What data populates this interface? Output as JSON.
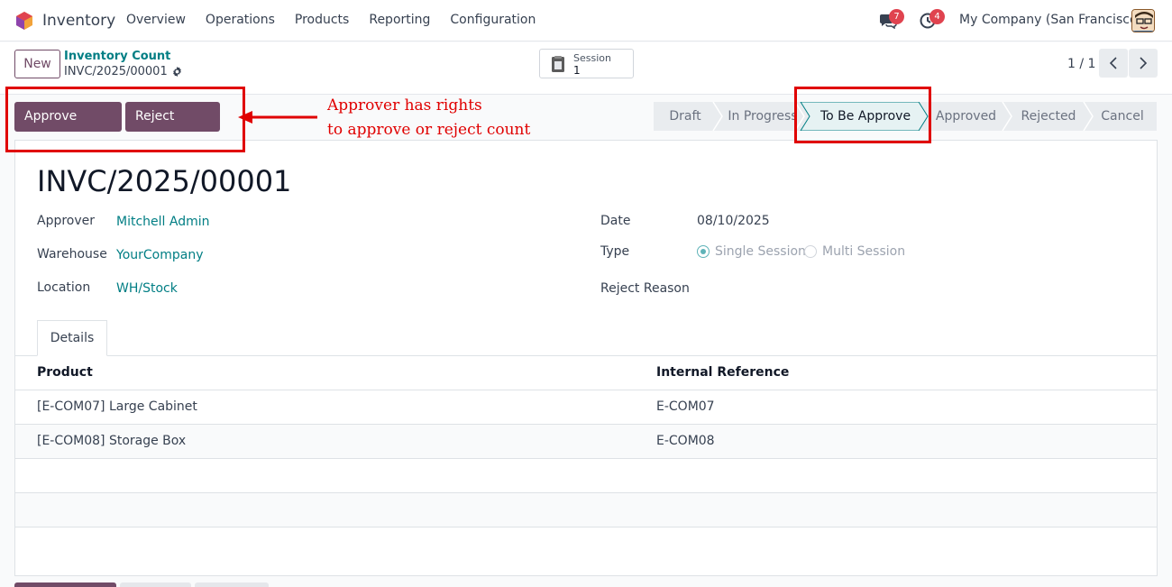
{
  "navbar": {
    "app_name": "Inventory",
    "menu": [
      "Overview",
      "Operations",
      "Products",
      "Reporting",
      "Configuration"
    ],
    "messages_count": "7",
    "activities_count": "4",
    "company": "My Company (San Francisco)"
  },
  "control": {
    "new_label": "New",
    "breadcrumb_parent": "Inventory Count",
    "breadcrumb_current": "INVC/2025/00001",
    "session_label": "Session",
    "session_value": "1",
    "pager": "1 / 1"
  },
  "actions": {
    "approve_label": "Approve Count",
    "reject_label": "Reject Count"
  },
  "statusbar": {
    "stages": [
      "Draft",
      "In Progress",
      "To Be Approve",
      "Approved",
      "Rejected",
      "Cancel"
    ],
    "active": "To Be Approve"
  },
  "annotation": {
    "line1": "Approver has rights",
    "line2": "to approve or reject count"
  },
  "record": {
    "title": "INVC/2025/00001",
    "approver_label": "Approver",
    "approver": "Mitchell Admin",
    "warehouse_label": "Warehouse",
    "warehouse": "YourCompany",
    "location_label": "Location",
    "location": "WH/Stock",
    "date_label": "Date",
    "date": "08/10/2025",
    "type_label": "Type",
    "type_options": [
      "Single Session",
      "Multi Session"
    ],
    "type_selected": "Single Session",
    "reject_reason_label": "Reject Reason"
  },
  "tabs": [
    "Details"
  ],
  "table": {
    "columns": [
      "Product",
      "Internal Reference"
    ],
    "rows": [
      [
        "[E-COM07] Large Cabinet",
        "E-COM07"
      ],
      [
        "[E-COM08] Storage Box",
        "E-COM08"
      ]
    ]
  },
  "colors": {
    "brand": "#714b67",
    "link": "#017e84",
    "annotation": "#e00000"
  }
}
